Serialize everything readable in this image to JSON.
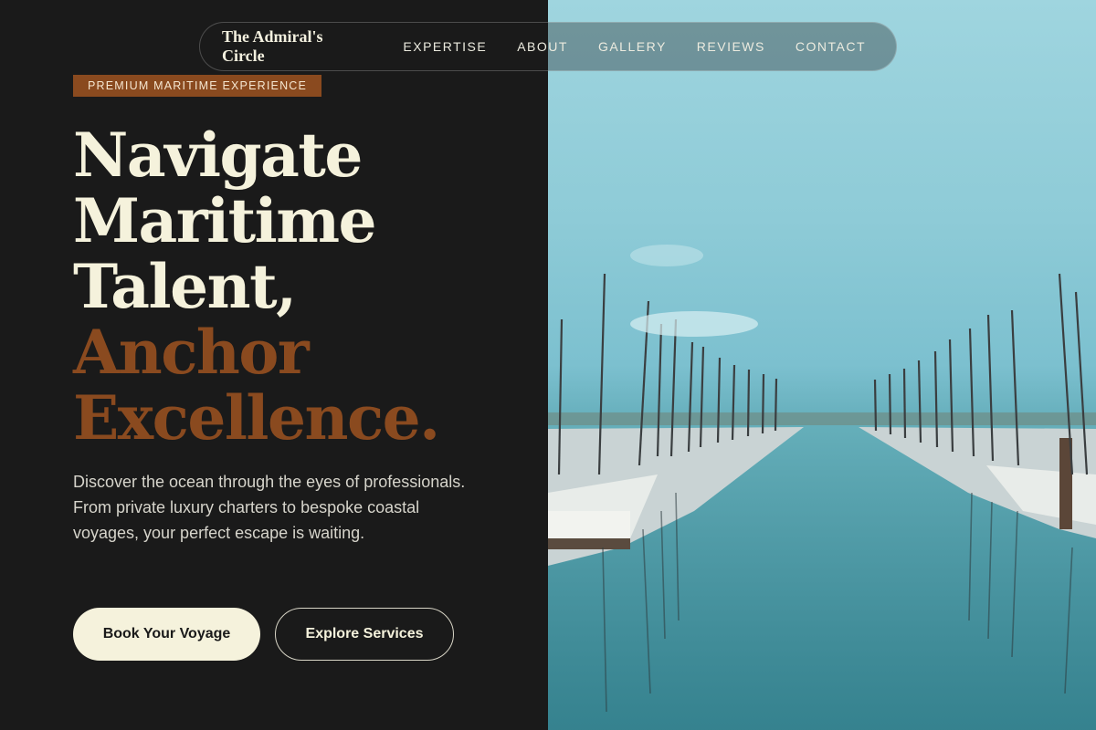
{
  "nav": {
    "brand": "The Admiral's Circle",
    "links": [
      "EXPERTISE",
      "ABOUT",
      "GALLERY",
      "REVIEWS",
      "CONTACT"
    ]
  },
  "hero": {
    "badge": "PREMIUM MARITIME EXPERIENCE",
    "headline_lines": [
      "Navigate",
      "Maritime",
      "Talent,"
    ],
    "headline_accent_lines": [
      "Anchor",
      "Excellence."
    ],
    "description": "Discover the ocean through the eyes of professionals. From private luxury charters to bespoke coastal voyages, your perfect escape is waiting.",
    "primary_button": "Book Your Voyage",
    "secondary_button": "Explore Services",
    "image_alt": "Marina with sailboat masts reflected in calm water"
  },
  "colors": {
    "background": "#1a1a1a",
    "cream": "#f5f2dc",
    "accent_brown": "#8a4a1f",
    "sky": "#9fd5df",
    "water": "#3c8794"
  }
}
